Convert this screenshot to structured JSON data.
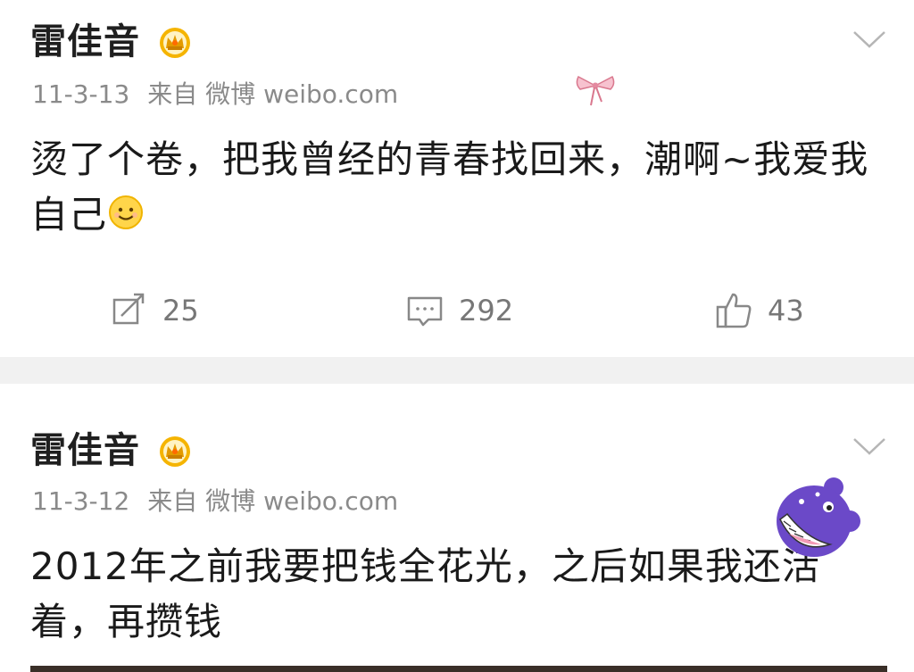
{
  "posts": [
    {
      "username": "雷佳音",
      "date": "11-3-13",
      "source": "来自 微博 weibo.com",
      "text": "烫了个卷，把我曾经的青春找回来，潮啊~我爱我自己",
      "reposts": "25",
      "comments": "292",
      "likes": "43"
    },
    {
      "username": "雷佳音",
      "date": "11-3-12",
      "source": "来自 微博 weibo.com",
      "text": "2012年之前我要把钱全花光，之后如果我还活着，再攒钱"
    }
  ],
  "icons": {
    "vip": "crown-badge-icon",
    "more": "chevron-down-icon",
    "repost": "repost-icon",
    "comment": "comment-icon",
    "like": "thumbs-up-icon",
    "emoji": "smile-emoji-icon"
  },
  "colors": {
    "text": "#1a1a1a",
    "meta": "#8a8a8a",
    "separator": "#f1f1f1",
    "badge": "#f0a500"
  }
}
